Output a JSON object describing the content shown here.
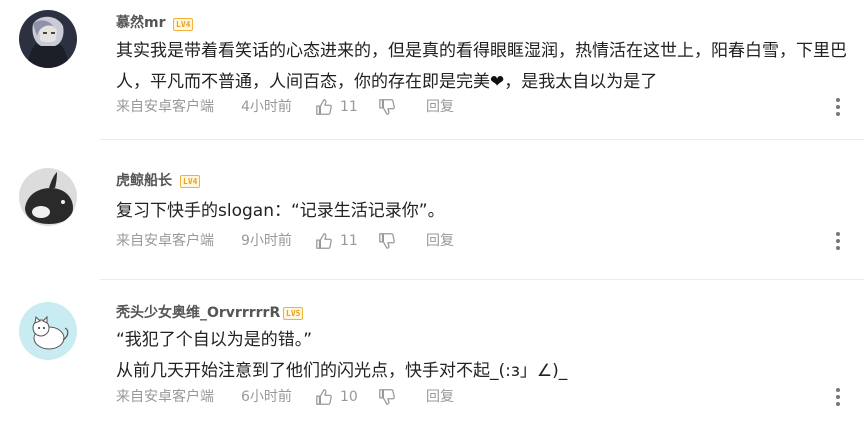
{
  "comments": [
    {
      "username": "慕然mr",
      "badge": "LV4",
      "content_lines": [
        "其实我是带着看笑话的心态进来的，但是真的看得眼眶湿润，热情活在这世上，阳春白雪，下里巴",
        "人，平凡而不普通，人间百态，你的存在即是完美",
        "，是我太自以为是了"
      ],
      "heart": "❤",
      "source": "来自安卓客户端",
      "time": "4小时前",
      "likes": "11",
      "reply": "回复"
    },
    {
      "username": "虎鲸船长",
      "badge": "LV4",
      "content_lines": [
        "复习下快手的slogan：“记录生活记录你”。"
      ],
      "source": "来自安卓客户端",
      "time": "9小时前",
      "likes": "11",
      "reply": "回复"
    },
    {
      "username": "秃头少女奥维_OrvrrrrrR",
      "badge": "LV5",
      "content_lines": [
        "“我犯了个自以为是的错。”",
        "从前几天开始注意到了他们的闪光点，快手对不起_(:з」∠)_"
      ],
      "source": "来自安卓客户端",
      "time": "6小时前",
      "likes": "10",
      "reply": "回复"
    }
  ],
  "icons": {
    "like": "thumbs-up-icon",
    "dislike": "thumbs-down-icon",
    "more": "more-vertical-icon"
  },
  "colors": {
    "badge": "#f0b23a",
    "meta_text": "#999999",
    "username": "#555555",
    "content": "#222222"
  }
}
